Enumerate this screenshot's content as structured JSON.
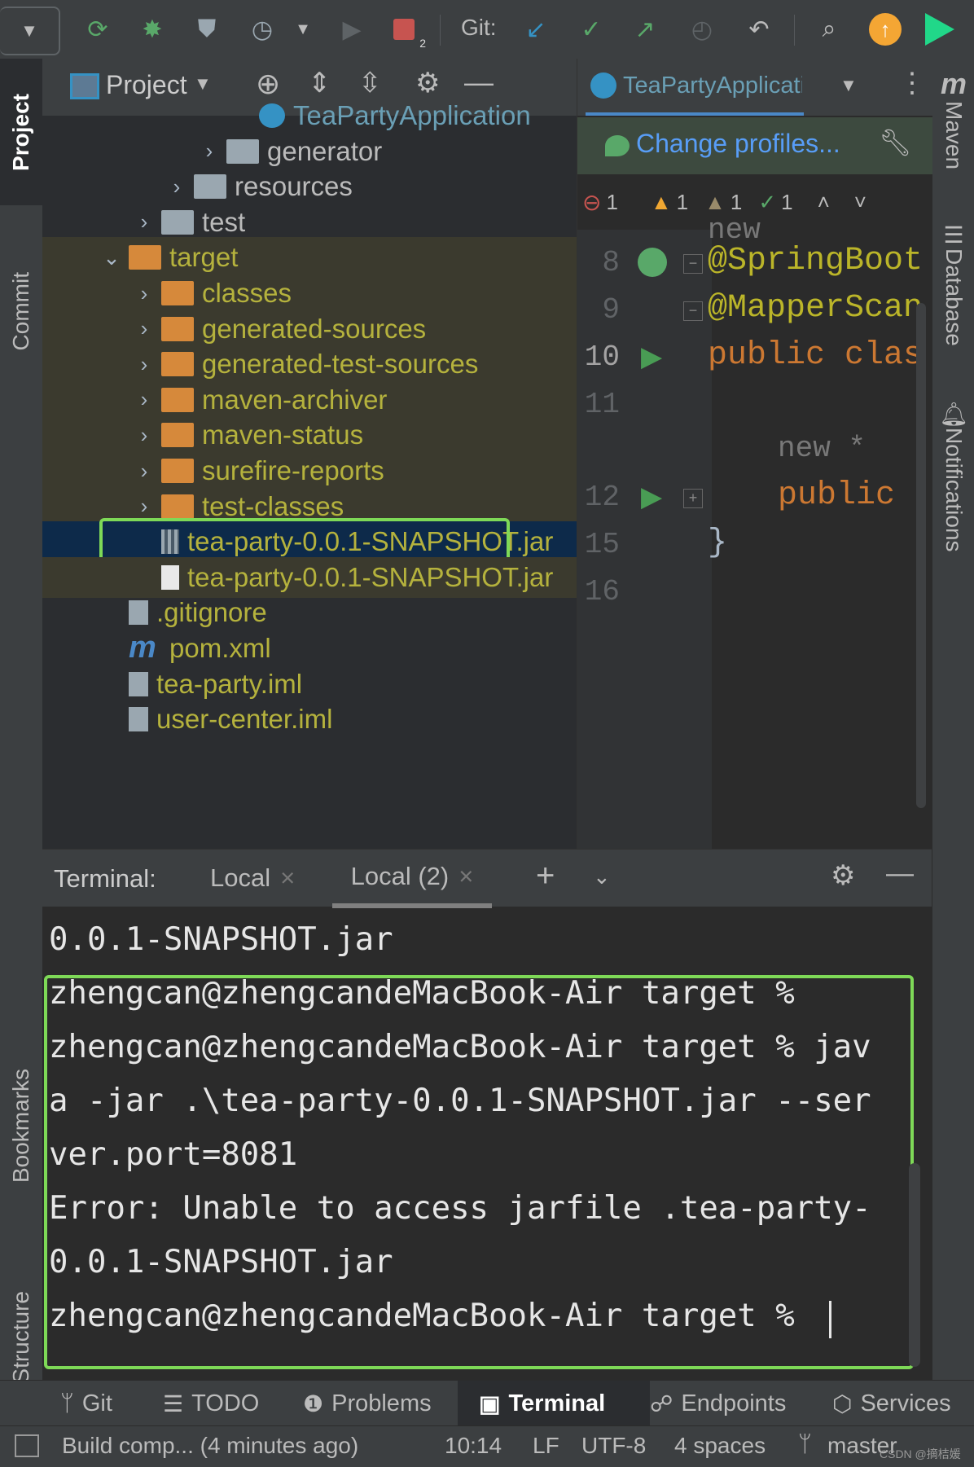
{
  "toolbar": {
    "git_label": "Git:",
    "icons": [
      "dropdown-icon",
      "refresh-icon",
      "debug-icon",
      "coverage-icon",
      "profile-icon",
      "run-icon",
      "stop-icon",
      "git-update-icon",
      "git-commit-icon",
      "git-push-icon",
      "history-icon",
      "rollback-icon",
      "search-icon",
      "update-icon",
      "jetbrains-icon"
    ],
    "stop_badge": "2"
  },
  "left_strip": {
    "tabs": [
      "Project",
      "Commit",
      "Bookmarks",
      "Structure"
    ]
  },
  "right_strip": {
    "tabs": [
      "Maven",
      "Database",
      "Notifications"
    ],
    "maven_glyph": "m"
  },
  "project": {
    "title": "Project",
    "tree": [
      {
        "label": "TeaPartyApplication",
        "type": "app",
        "depth": 6,
        "arrow": ""
      },
      {
        "label": "generator",
        "type": "folder-grey",
        "depth": 5,
        "arrow": "›"
      },
      {
        "label": "resources",
        "type": "folder-res",
        "depth": 4,
        "arrow": "›"
      },
      {
        "label": "test",
        "type": "folder-grey",
        "depth": 3,
        "arrow": "›"
      },
      {
        "label": "target",
        "type": "folder-orange",
        "depth": 2,
        "arrow": "⌄"
      },
      {
        "label": "classes",
        "type": "folder-orange",
        "depth": 3,
        "arrow": "›"
      },
      {
        "label": "generated-sources",
        "type": "folder-orange",
        "depth": 3,
        "arrow": "›"
      },
      {
        "label": "generated-test-sources",
        "type": "folder-orange",
        "depth": 3,
        "arrow": "›"
      },
      {
        "label": "maven-archiver",
        "type": "folder-orange",
        "depth": 3,
        "arrow": "›"
      },
      {
        "label": "maven-status",
        "type": "folder-orange",
        "depth": 3,
        "arrow": "›"
      },
      {
        "label": "surefire-reports",
        "type": "folder-orange",
        "depth": 3,
        "arrow": "›"
      },
      {
        "label": "test-classes",
        "type": "folder-orange",
        "depth": 3,
        "arrow": "›"
      },
      {
        "label": "tea-party-0.0.1-SNAPSHOT.jar",
        "type": "jar",
        "depth": 3,
        "arrow": ""
      },
      {
        "label": "tea-party-0.0.1-SNAPSHOT.jar",
        "type": "file",
        "depth": 3,
        "arrow": ""
      },
      {
        "label": ".gitignore",
        "type": "gitignore",
        "depth": 2,
        "arrow": ""
      },
      {
        "label": "pom.xml",
        "type": "maven",
        "depth": 2,
        "arrow": ""
      },
      {
        "label": "tea-party.iml",
        "type": "iml",
        "depth": 2,
        "arrow": ""
      },
      {
        "label": "user-center.iml",
        "type": "iml",
        "depth": 2,
        "arrow": ""
      }
    ]
  },
  "editor": {
    "tab_label": "TeaPartyApplicati",
    "profile_banner": "Change profiles...",
    "inspections": {
      "errors": "1",
      "warnings": "1",
      "weak_warnings": "1",
      "typos": "1"
    },
    "top_fragment": "new",
    "lines": [
      {
        "num": "8",
        "text": "@SpringBoot",
        "kind": "annotation"
      },
      {
        "num": "9",
        "text": "@MapperScan",
        "kind": "annotation"
      },
      {
        "num": "10",
        "text": "public clas",
        "kind": "keyword"
      },
      {
        "num": "11",
        "text": "",
        "kind": "plain"
      },
      {
        "num": "",
        "text": "new *",
        "kind": "hint"
      },
      {
        "num": "12",
        "text": "public",
        "kind": "keyword"
      },
      {
        "num": "15",
        "text": "}",
        "kind": "plain"
      },
      {
        "num": "16",
        "text": "",
        "kind": "plain"
      }
    ]
  },
  "terminal": {
    "label": "Terminal:",
    "tabs": [
      "Local",
      "Local (2)"
    ],
    "lines": [
      "0.0.1-SNAPSHOT.jar",
      "zhengcan@zhengcandeMacBook-Air target %",
      "zhengcan@zhengcandeMacBook-Air target % jav",
      "a -jar .\\tea-party-0.0.1-SNAPSHOT.jar --ser",
      "ver.port=8081",
      "Error: Unable to access jarfile .tea-party-",
      "0.0.1-SNAPSHOT.jar",
      "zhengcan@zhengcandeMacBook-Air target %"
    ]
  },
  "bottom_tools": {
    "items": [
      "Git",
      "TODO",
      "Problems",
      "Terminal",
      "Endpoints",
      "Services"
    ],
    "active": "Terminal"
  },
  "status": {
    "build": "Build comp... (4 minutes ago)",
    "position": "10:14",
    "line_sep": "LF",
    "encoding": "UTF-8",
    "indent": "4 spaces",
    "branch": "master",
    "watermark": "CSDN @摘桔媛"
  },
  "colors": {
    "highlight_green": "#7ed957",
    "folder_orange": "#d6893b",
    "target_text": "#b5b23d",
    "selection": "#0d2a4a",
    "keyword": "#cc7832",
    "annotation": "#bbb529",
    "run_green": "#499c54"
  }
}
